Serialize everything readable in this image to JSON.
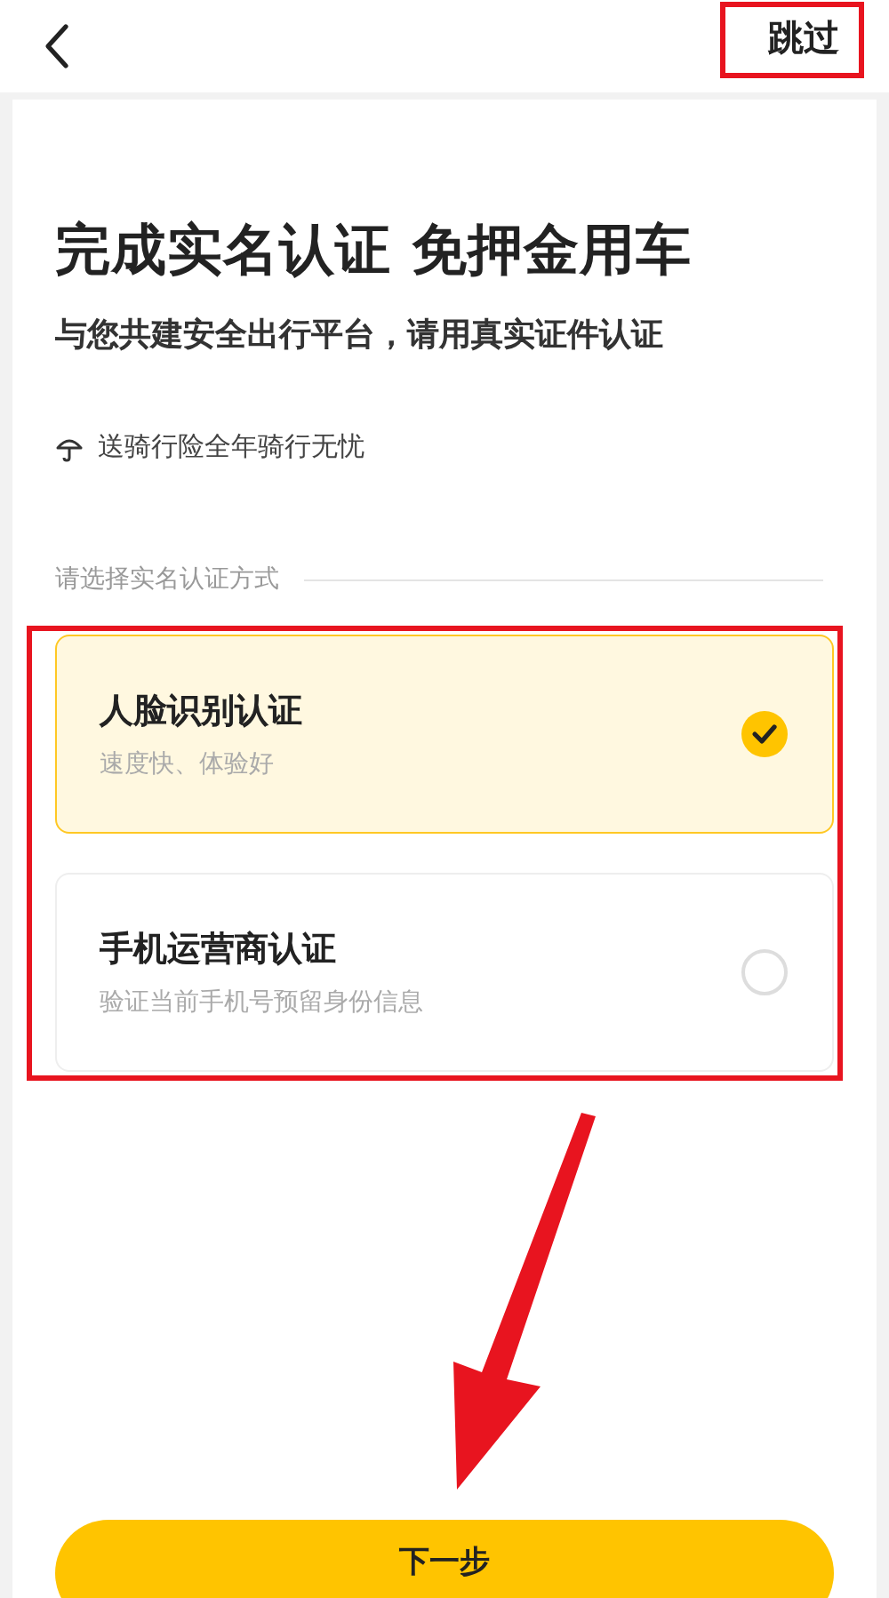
{
  "nav": {
    "skip": "跳过"
  },
  "title": "完成实名认证 免押金用车",
  "subtitle": "与您共建安全出行平台，请用真实证件认证",
  "perk": "送骑行险全年骑行无忧",
  "section_label": "请选择实名认证方式",
  "options": [
    {
      "title": "人脸识别认证",
      "desc": "速度快、体验好",
      "selected": true
    },
    {
      "title": "手机运营商认证",
      "desc": "验证当前手机号预留身份信息",
      "selected": false
    }
  ],
  "next_button": "下一步"
}
